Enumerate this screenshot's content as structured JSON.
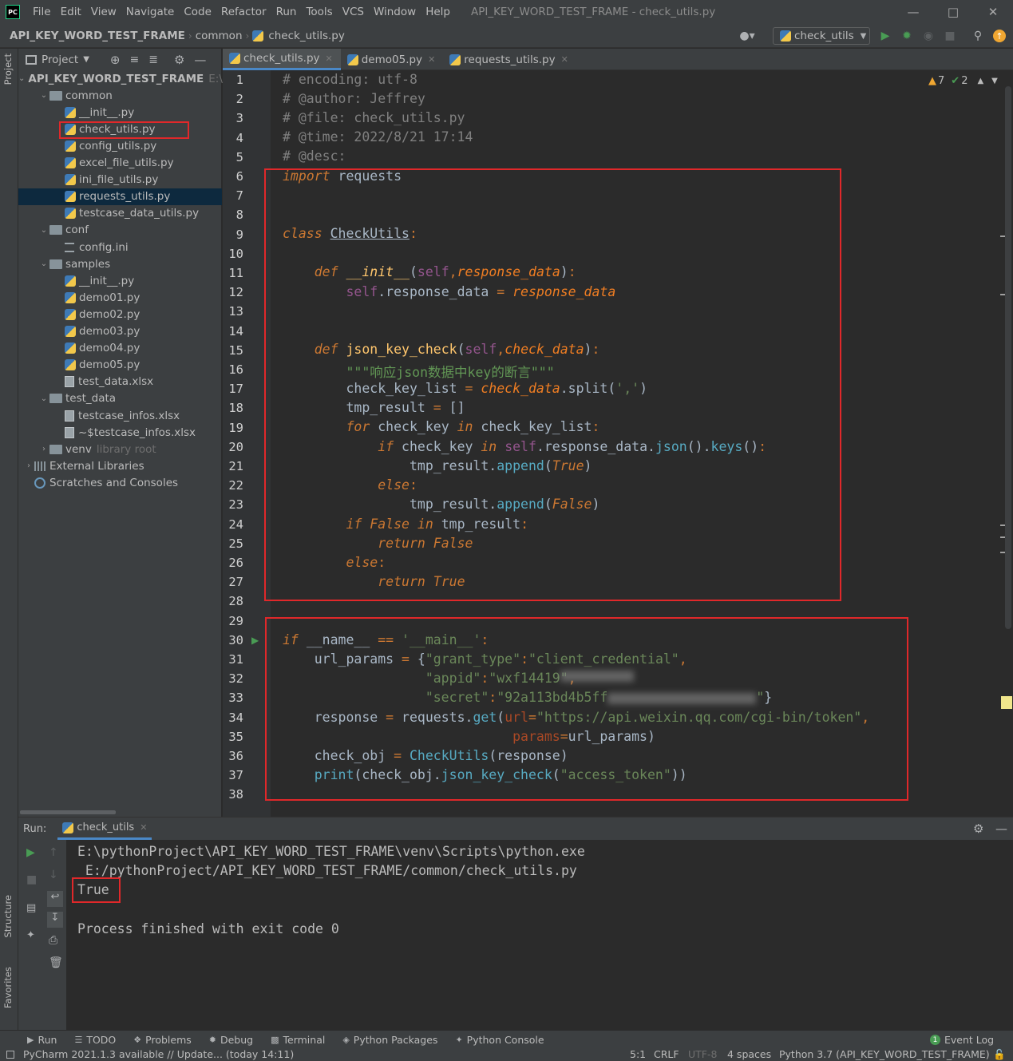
{
  "menubar": {
    "logo": "PC",
    "items": [
      "File",
      "Edit",
      "View",
      "Navigate",
      "Code",
      "Refactor",
      "Run",
      "Tools",
      "VCS",
      "Window",
      "Help"
    ],
    "window_title": "API_KEY_WORD_TEST_FRAME - check_utils.py"
  },
  "navbar": {
    "crumbs": [
      "API_KEY_WORD_TEST_FRAME",
      "common",
      "check_utils.py"
    ],
    "run_config": "check_utils"
  },
  "left_stripe": {
    "project": "Project",
    "structure": "Structure",
    "favorites": "Favorites"
  },
  "project": {
    "header": "Project",
    "tree": [
      {
        "label": "API_KEY_WORD_TEST_FRAME",
        "extra": "E:\\",
        "type": "folder",
        "level": 0,
        "open": true
      },
      {
        "label": "common",
        "type": "folder",
        "level": 1,
        "open": true
      },
      {
        "label": "__init__.py",
        "type": "py",
        "level": 2
      },
      {
        "label": "check_utils.py",
        "type": "py",
        "level": 2
      },
      {
        "label": "config_utils.py",
        "type": "py",
        "level": 2
      },
      {
        "label": "excel_file_utils.py",
        "type": "py",
        "level": 2
      },
      {
        "label": "ini_file_utils.py",
        "type": "py",
        "level": 2
      },
      {
        "label": "requests_utils.py",
        "type": "py",
        "level": 2,
        "selected": true
      },
      {
        "label": "testcase_data_utils.py",
        "type": "py",
        "level": 2
      },
      {
        "label": "conf",
        "type": "folder",
        "level": 1,
        "open": true
      },
      {
        "label": "config.ini",
        "type": "ini",
        "level": 2
      },
      {
        "label": "samples",
        "type": "folder",
        "level": 1,
        "open": true
      },
      {
        "label": "__init__.py",
        "type": "py",
        "level": 2
      },
      {
        "label": "demo01.py",
        "type": "py",
        "level": 2
      },
      {
        "label": "demo02.py",
        "type": "py",
        "level": 2
      },
      {
        "label": "demo03.py",
        "type": "py",
        "level": 2
      },
      {
        "label": "demo04.py",
        "type": "py",
        "level": 2
      },
      {
        "label": "demo05.py",
        "type": "py",
        "level": 2
      },
      {
        "label": "test_data.xlsx",
        "type": "xls",
        "level": 2
      },
      {
        "label": "test_data",
        "type": "folder",
        "level": 1,
        "open": true
      },
      {
        "label": "testcase_infos.xlsx",
        "type": "xls",
        "level": 2
      },
      {
        "label": "~$testcase_infos.xlsx",
        "type": "xls",
        "level": 2
      },
      {
        "label": "venv",
        "extra": "library root",
        "type": "folder",
        "level": 1,
        "open": false
      },
      {
        "label": "External Libraries",
        "type": "lib",
        "level": 0,
        "open": false
      },
      {
        "label": "Scratches and Consoles",
        "type": "scratch",
        "level": 0
      }
    ]
  },
  "tabs": [
    {
      "label": "check_utils.py",
      "active": true
    },
    {
      "label": "demo05.py",
      "active": false
    },
    {
      "label": "requests_utils.py",
      "active": false
    }
  ],
  "editor": {
    "inspections": {
      "warnings": "7",
      "ok": "2"
    },
    "line_numbers": [
      "1",
      "2",
      "3",
      "4",
      "5",
      "6",
      "7",
      "8",
      "9",
      "10",
      "11",
      "12",
      "13",
      "14",
      "15",
      "16",
      "17",
      "18",
      "19",
      "20",
      "21",
      "22",
      "23",
      "24",
      "25",
      "26",
      "27",
      "28",
      "29",
      "30",
      "31",
      "32",
      "33",
      "34",
      "35",
      "36",
      "37",
      "38"
    ],
    "code": {
      "l1": "# encoding: utf-8",
      "l2": "# @author: Jeffrey",
      "l3": "# @file: check_utils.py",
      "l4": "# @time: 2022/8/21 17:14",
      "l5": "# @desc:",
      "import_kw": "import",
      "import_mod": " requests",
      "class_kw": "class",
      "class_name": "CheckUtils",
      "def_kw": "def",
      "init_name": "__init__",
      "self": "self",
      "param_response_data": "response_data",
      "attr_response_data": ".response_data",
      "func_json_key_check": "json_key_check",
      "param_check_data": "check_data",
      "docstring": "\"\"\"响应json数据中key的断言\"\"\"",
      "check_key_list": "check_key_list",
      "split": ".split(",
      "split_arg": "','",
      "tmp_result": "tmp_result",
      "for_kw": "for",
      "in_kw": "in",
      "check_key": "check_key",
      "if_kw": "if",
      "json_call": "json",
      "keys_call": "keys",
      "append": "append",
      "true": "True",
      "false": "False",
      "else_kw": "else",
      "return_kw": "return",
      "name_dunder": "__name__",
      "main_str": "'__main__'",
      "url_params": "url_params",
      "grant_type_key": "\"grant_type\"",
      "grant_type_val": "\"client_credential\"",
      "appid_key": "\"appid\"",
      "appid_val": "\"wxf14419",
      "secret_key": "\"secret\"",
      "secret_val": "\"92a113bd4b5ff",
      "response": "response",
      "requests_get": "requests.",
      "get": "get",
      "url_kw": "url",
      "url_val": "\"https://api.weixin.qq.com/cgi-bin/token\"",
      "params_kw": "params",
      "check_obj": "check_obj",
      "print_fn": "print",
      "access_token": "\"access_token\""
    }
  },
  "run": {
    "label": "Run:",
    "tab": "check_utils",
    "lines": [
      "E:\\pythonProject\\API_KEY_WORD_TEST_FRAME\\venv\\Scripts\\python.exe",
      " E:/pythonProject/API_KEY_WORD_TEST_FRAME/common/check_utils.py",
      "True",
      "",
      "Process finished with exit code 0"
    ]
  },
  "tool_windows": [
    "Run",
    "TODO",
    "Problems",
    "Debug",
    "Terminal",
    "Python Packages",
    "Python Console"
  ],
  "event_log": {
    "badge": "1",
    "label": "Event Log"
  },
  "status": {
    "message": "PyCharm 2021.1.3 available // Update... (today 14:11)",
    "position": "5:1",
    "line_sep": "CRLF",
    "encoding": "UTF-8",
    "indent": "4 spaces",
    "interpreter": "Python 3.7 (API_KEY_WORD_TEST_FRAME)"
  },
  "colors": {
    "background": "#2b2b2b",
    "panel": "#3c3f41",
    "keyword": "#cc7832",
    "string": "#6a8759",
    "function": "#ffc66d",
    "highlight_box": "#e0282a",
    "selection": "#0d293e"
  }
}
